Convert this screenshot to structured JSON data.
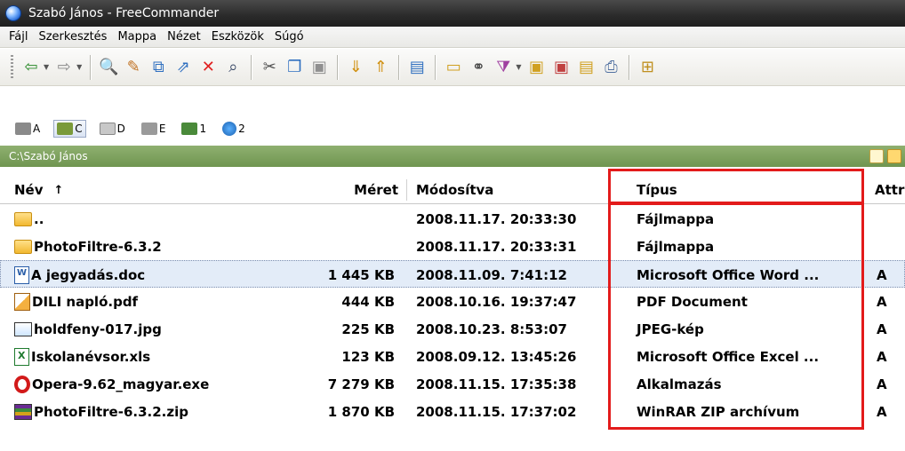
{
  "window": {
    "title": "Szabó János - FreeCommander"
  },
  "menu": [
    "Fájl",
    "Szerkesztés",
    "Mappa",
    "Nézet",
    "Eszközök",
    "Súgó"
  ],
  "drives": [
    {
      "letter": "A",
      "icon": "floppy-drive-icon",
      "active": false
    },
    {
      "letter": "C",
      "icon": "hard-drive-icon",
      "active": true
    },
    {
      "letter": "D",
      "icon": "cd-drive-icon",
      "active": false
    },
    {
      "letter": "E",
      "icon": "removable-drive-icon",
      "active": false
    },
    {
      "letter": "1",
      "icon": "network-drive-icon",
      "active": false
    },
    {
      "letter": "2",
      "icon": "ftp-icon",
      "active": false
    }
  ],
  "path": "C:\\Szabó János",
  "columns": {
    "name": "Név",
    "size": "Méret",
    "modified": "Módosítva",
    "type": "Típus",
    "attr": "Attr"
  },
  "sort_indicator": "↑",
  "files": [
    {
      "name": "..",
      "size": "",
      "modified": "2008.11.17. 20:33:30",
      "type": "Fájlmappa",
      "attr": "",
      "icon": "folder-icon",
      "selected": false
    },
    {
      "name": "PhotoFiltre-6.3.2",
      "size": "",
      "modified": "2008.11.17. 20:33:31",
      "type": "Fájlmappa",
      "attr": "",
      "icon": "folder-icon",
      "selected": false
    },
    {
      "name": "A jegyadás.doc",
      "size": "1 445 KB",
      "modified": "2008.11.09. 7:41:12",
      "type": "Microsoft Office Word ...",
      "attr": "A",
      "icon": "word-doc-icon",
      "selected": true
    },
    {
      "name": "DILI napló.pdf",
      "size": "444 KB",
      "modified": "2008.10.16. 19:37:47",
      "type": "PDF Document",
      "attr": "A",
      "icon": "pdf-icon",
      "selected": false
    },
    {
      "name": "holdfeny-017.jpg",
      "size": "225 KB",
      "modified": "2008.10.23. 8:53:07",
      "type": "JPEG-kép",
      "attr": "A",
      "icon": "image-icon",
      "selected": false
    },
    {
      "name": "Iskolanévsor.xls",
      "size": "123 KB",
      "modified": "2008.09.12. 13:45:26",
      "type": "Microsoft Office Excel ...",
      "attr": "A",
      "icon": "excel-icon",
      "selected": false
    },
    {
      "name": "Opera-9.62_magyar.exe",
      "size": "7 279 KB",
      "modified": "2008.11.15. 17:35:38",
      "type": "Alkalmazás",
      "attr": "A",
      "icon": "opera-icon",
      "selected": false
    },
    {
      "name": "PhotoFiltre-6.3.2.zip",
      "size": "1 870 KB",
      "modified": "2008.11.15. 17:37:02",
      "type": "WinRAR ZIP archívum",
      "attr": "A",
      "icon": "winrar-icon",
      "selected": false
    }
  ],
  "colors": {
    "highlight": "#e31b1b",
    "pathbar": "#7a9f5a",
    "selection": "#e3ecf8"
  }
}
